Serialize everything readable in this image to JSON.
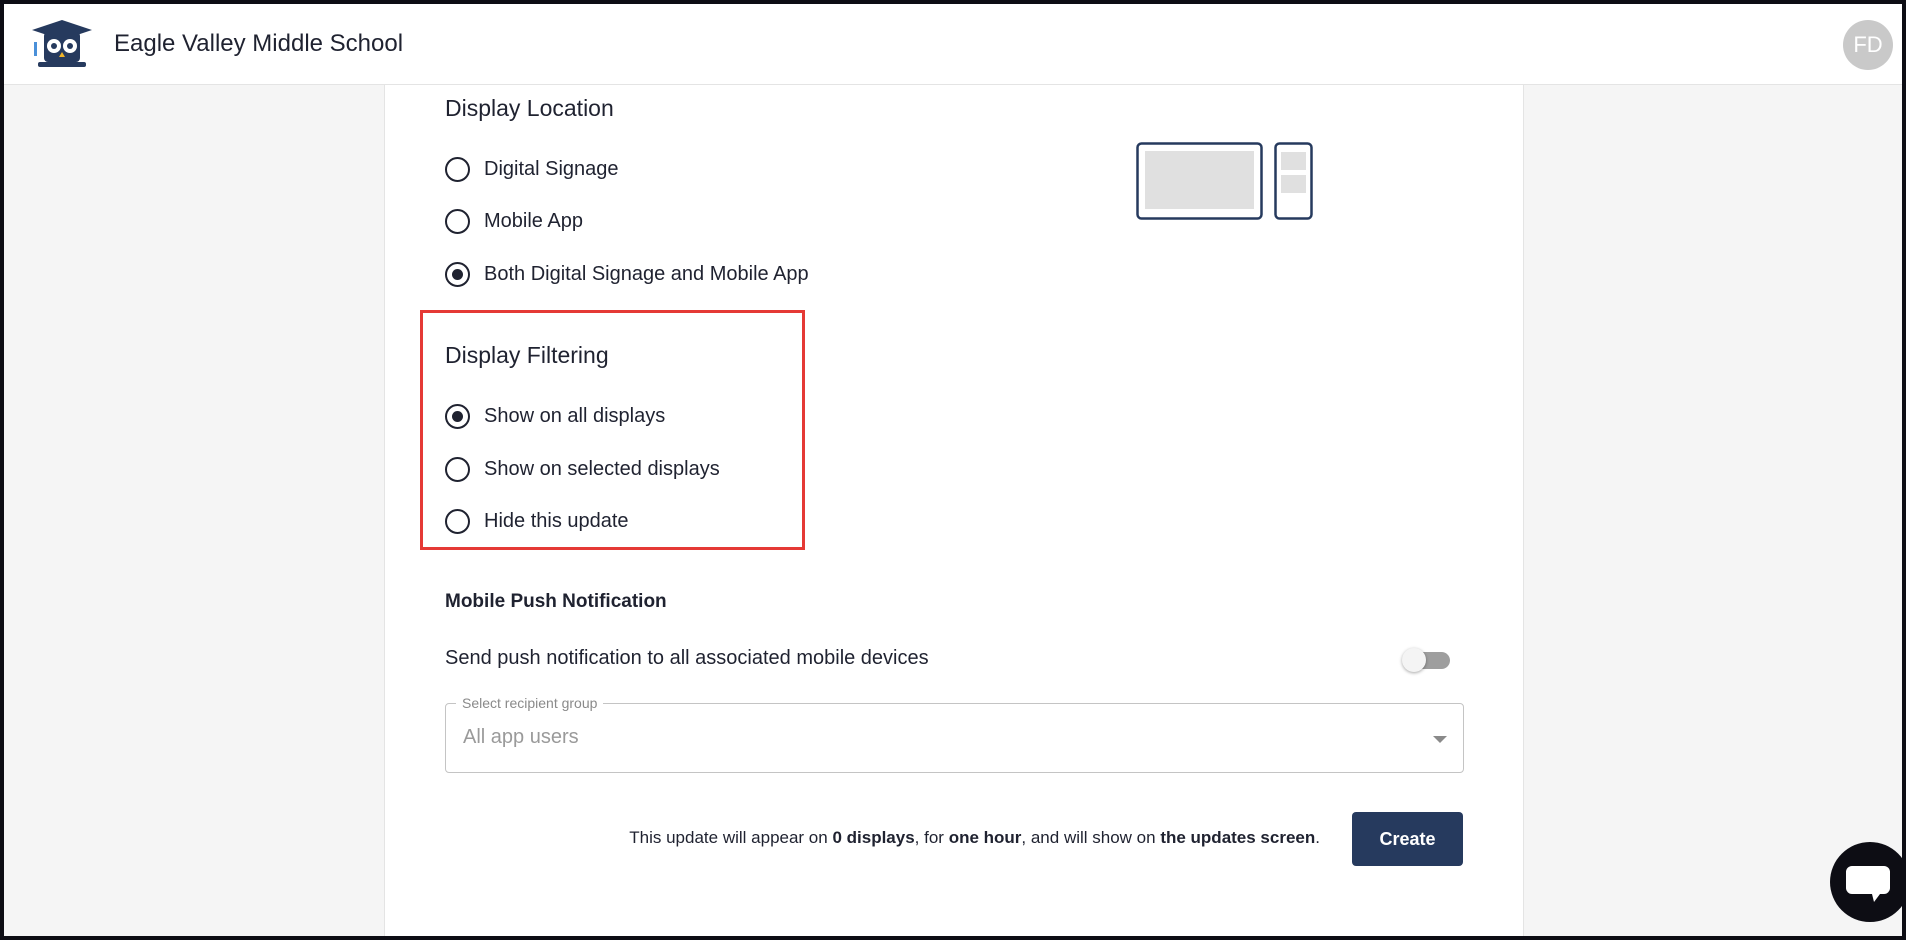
{
  "header": {
    "school_name": "Eagle Valley Middle School",
    "avatar_initials": "FD"
  },
  "display_location": {
    "title": "Display Location",
    "options": [
      {
        "label": "Digital Signage",
        "selected": false
      },
      {
        "label": "Mobile App",
        "selected": false
      },
      {
        "label": "Both Digital Signage and Mobile App",
        "selected": true
      }
    ]
  },
  "display_filtering": {
    "title": "Display Filtering",
    "options": [
      {
        "label": "Show on all displays",
        "selected": true
      },
      {
        "label": "Show on selected displays",
        "selected": false
      },
      {
        "label": "Hide this update",
        "selected": false
      }
    ]
  },
  "push": {
    "title": "Mobile Push Notification",
    "toggle_label": "Send push notification to all associated mobile devices",
    "toggle_on": false,
    "recipient_legend": "Select recipient group",
    "recipient_value": "All app users"
  },
  "summary": {
    "prefix": "This update will appear on ",
    "displays": "0 displays",
    "mid1": ", for ",
    "duration": "one hour",
    "mid2": ", and will show on ",
    "screen": "the updates screen",
    "suffix": "."
  },
  "actions": {
    "create_label": "Create"
  },
  "colors": {
    "primary": "#263a5e",
    "highlight": "#e53935",
    "text": "#1f2230"
  },
  "icons": {
    "logo": "owl-graduation-cap-icon",
    "device_preview": "display-and-phone-icon",
    "chat": "chat-bubble-icon",
    "dropdown": "caret-down-icon"
  }
}
